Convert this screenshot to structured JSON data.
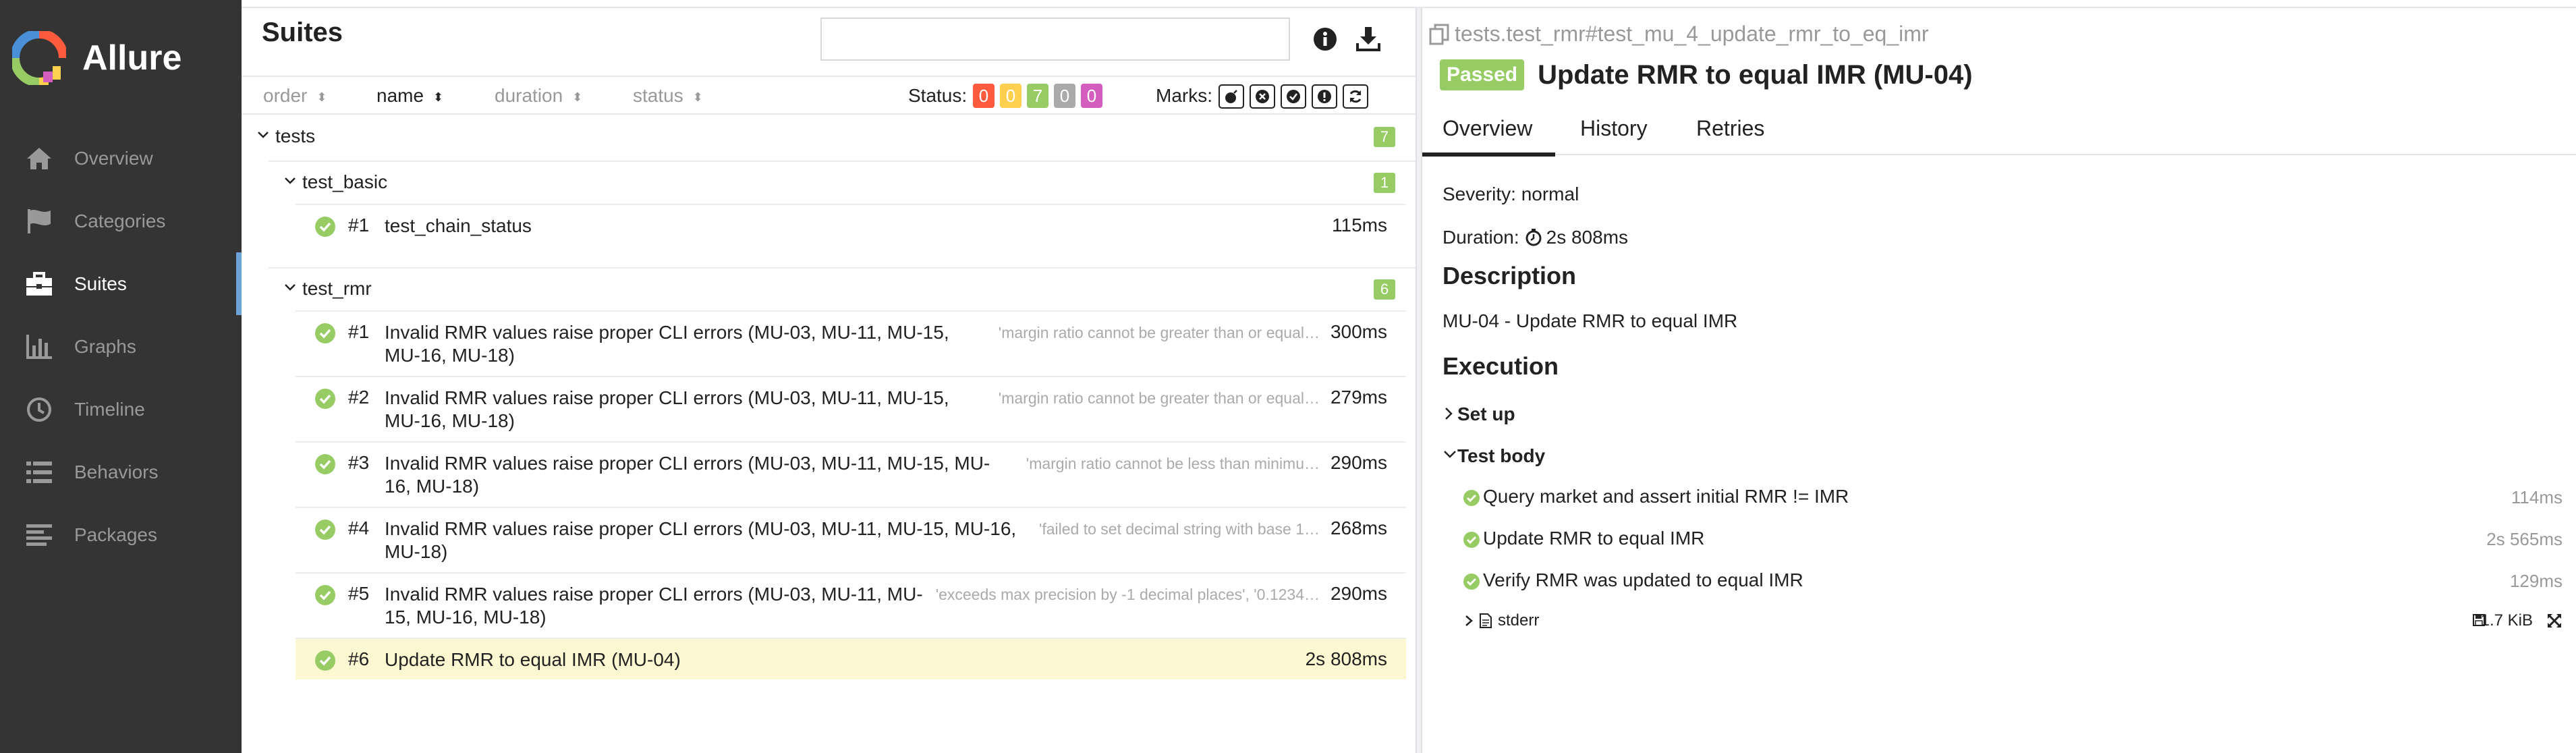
{
  "app": {
    "name": "Allure"
  },
  "nav": [
    {
      "label": "Overview",
      "icon": "home-icon"
    },
    {
      "label": "Categories",
      "icon": "flag-icon"
    },
    {
      "label": "Suites",
      "icon": "briefcase-icon",
      "active": true
    },
    {
      "label": "Graphs",
      "icon": "bar-chart-icon"
    },
    {
      "label": "Timeline",
      "icon": "clock-icon"
    },
    {
      "label": "Behaviors",
      "icon": "list-icon"
    },
    {
      "label": "Packages",
      "icon": "align-left-icon"
    }
  ],
  "suites": {
    "title": "Suites",
    "search_placeholder": "",
    "sort": {
      "order": "order",
      "name": "name",
      "duration": "duration",
      "status": "status"
    },
    "status_label": "Status:",
    "status_counts": [
      {
        "value": "0",
        "color": "#fd5a3e"
      },
      {
        "value": "0",
        "color": "#ffd050"
      },
      {
        "value": "7",
        "color": "#97cc64"
      },
      {
        "value": "0",
        "color": "#aaaaaa"
      },
      {
        "value": "0",
        "color": "#d35ebe"
      }
    ],
    "marks_label": "Marks:",
    "groups": [
      {
        "label": "tests",
        "count": "7"
      },
      {
        "label": "test_basic",
        "count": "1"
      },
      {
        "label": "test_rmr",
        "count": "6"
      }
    ],
    "basic_rows": [
      {
        "num": "#1",
        "name": "test_chain_status",
        "message": "",
        "duration": "115ms"
      }
    ],
    "rmr_rows": [
      {
        "num": "#1",
        "name": "Invalid RMR values raise proper CLI errors (MU-03, MU-11, MU-15, MU-16, MU-18)",
        "message": "'margin ratio cannot be greater than or equal…",
        "duration": "300ms"
      },
      {
        "num": "#2",
        "name": "Invalid RMR values raise proper CLI errors (MU-03, MU-11, MU-15, MU-16, MU-18)",
        "message": "'margin ratio cannot be greater than or equal…",
        "duration": "279ms"
      },
      {
        "num": "#3",
        "name": "Invalid RMR values raise proper CLI errors (MU-03, MU-11, MU-15, MU-16, MU-18)",
        "message": "'margin ratio cannot be less than minimu…",
        "duration": "290ms"
      },
      {
        "num": "#4",
        "name": "Invalid RMR values raise proper CLI errors (MU-03, MU-11, MU-15, MU-16, MU-18)",
        "message": "'failed to set decimal string with base 1…",
        "duration": "268ms"
      },
      {
        "num": "#5",
        "name": "Invalid RMR values raise proper CLI errors (MU-03, MU-11, MU-15, MU-16, MU-18)",
        "message": "'exceeds max precision by -1 decimal places', '0.1234…",
        "duration": "290ms"
      },
      {
        "num": "#6",
        "name": "Update RMR to equal IMR (MU-04)",
        "message": "",
        "duration": "2s 808ms"
      }
    ]
  },
  "detail": {
    "path": "tests.test_rmr#test_mu_4_update_rmr_to_eq_imr",
    "status": "Passed",
    "title": "Update RMR to equal IMR (MU-04)",
    "tabs": [
      "Overview",
      "History",
      "Retries"
    ],
    "severity": "Severity: normal",
    "duration_label": "Duration:",
    "duration": "2s 808ms",
    "description_heading": "Description",
    "description": "MU-04 - Update RMR to equal IMR",
    "execution_heading": "Execution",
    "setup_label": "Set up",
    "body_label": "Test body",
    "steps": [
      {
        "label": "Query market and assert initial RMR != IMR",
        "duration": "114ms"
      },
      {
        "label": "Update RMR to equal IMR",
        "duration": "2s 565ms"
      },
      {
        "label": "Verify RMR was updated to equal IMR",
        "duration": "129ms"
      }
    ],
    "attachment": {
      "name": "stderr",
      "size": "1.7 KiB"
    }
  }
}
